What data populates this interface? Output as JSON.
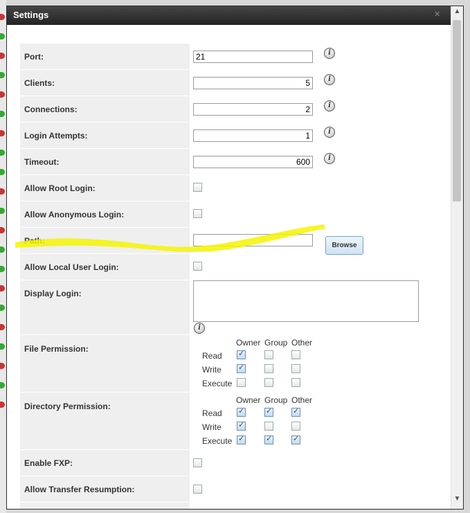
{
  "dialog": {
    "title": "Settings"
  },
  "fields": {
    "port": {
      "label": "Port:",
      "value": "21"
    },
    "clients": {
      "label": "Clients:",
      "value": "5"
    },
    "connections": {
      "label": "Connections:",
      "value": "2"
    },
    "login_attempts": {
      "label": "Login Attempts:",
      "value": "1"
    },
    "timeout": {
      "label": "Timeout:",
      "value": "600"
    },
    "allow_root_login": {
      "label": "Allow Root Login:",
      "checked": false
    },
    "allow_anonymous_login": {
      "label": "Allow Anonymous Login:",
      "checked": false
    },
    "path": {
      "label": "Path:",
      "value": "",
      "browse_label": "Browse"
    },
    "allow_local_user_login": {
      "label": "Allow Local User Login:",
      "checked": false
    },
    "display_login": {
      "label": "Display Login:",
      "value": ""
    },
    "enable_fxp": {
      "label": "Enable FXP:",
      "checked": false
    },
    "allow_transfer_resumption": {
      "label": "Allow Transfer Resumption:",
      "checked": false
    }
  },
  "permissions": {
    "columns": [
      "Owner",
      "Group",
      "Other"
    ],
    "file": {
      "label": "File Permission:",
      "rows": [
        {
          "name": "Read",
          "values": [
            true,
            false,
            false
          ]
        },
        {
          "name": "Write",
          "values": [
            true,
            false,
            false
          ]
        },
        {
          "name": "Execute",
          "values": [
            false,
            false,
            false
          ]
        }
      ]
    },
    "directory": {
      "label": "Directory Permission:",
      "rows": [
        {
          "name": "Read",
          "values": [
            true,
            true,
            true
          ]
        },
        {
          "name": "Write",
          "values": [
            true,
            false,
            false
          ]
        },
        {
          "name": "Execute",
          "values": [
            true,
            true,
            true
          ]
        }
      ]
    }
  },
  "icons": {
    "info": "info-icon",
    "close": "close-icon"
  },
  "colors": {
    "titlebar": "#2a2a2a",
    "label_bg": "#efefef",
    "highlight": "#f4f400"
  }
}
